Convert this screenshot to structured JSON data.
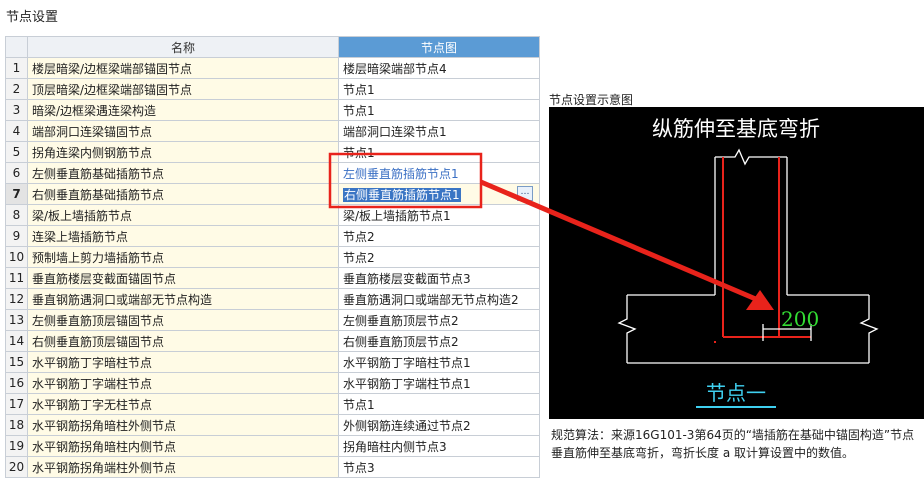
{
  "page_title": "节点设置",
  "table": {
    "col_name": "名称",
    "col_value": "节点图",
    "rows": [
      {
        "num": "1",
        "name": "楼层暗梁/边框梁端部锚固节点",
        "value": "楼层暗梁端部节点4"
      },
      {
        "num": "2",
        "name": "顶层暗梁/边框梁端部锚固节点",
        "value": "节点1"
      },
      {
        "num": "3",
        "name": "暗梁/边框梁遇连梁构造",
        "value": "节点1"
      },
      {
        "num": "4",
        "name": "端部洞口连梁锚固节点",
        "value": "端部洞口连梁节点1"
      },
      {
        "num": "5",
        "name": "拐角连梁内侧钢筋节点",
        "value": "节点1"
      },
      {
        "num": "6",
        "name": "左侧垂直筋基础插筋节点",
        "value": "左侧垂直筋插筋节点1"
      },
      {
        "num": "7",
        "name": "右侧垂直筋基础插筋节点",
        "value": "右侧垂直筋插筋节点1"
      },
      {
        "num": "8",
        "name": "梁/板上墙插筋节点",
        "value": "梁/板上墙插筋节点1"
      },
      {
        "num": "9",
        "name": "连梁上墙插筋节点",
        "value": "节点2"
      },
      {
        "num": "10",
        "name": "预制墙上剪力墙插筋节点",
        "value": "节点2"
      },
      {
        "num": "11",
        "name": "垂直筋楼层变截面锚固节点",
        "value": "垂直筋楼层变截面节点3"
      },
      {
        "num": "12",
        "name": "垂直钢筋遇洞口或端部无节点构造",
        "value": "垂直筋遇洞口或端部无节点构造2"
      },
      {
        "num": "13",
        "name": "左侧垂直筋顶层锚固节点",
        "value": "左侧垂直筋顶层节点2"
      },
      {
        "num": "14",
        "name": "右侧垂直筋顶层锚固节点",
        "value": "右侧垂直筋顶层节点2"
      },
      {
        "num": "15",
        "name": "水平钢筋丁字暗柱节点",
        "value": "水平钢筋丁字暗柱节点1"
      },
      {
        "num": "16",
        "name": "水平钢筋丁字端柱节点",
        "value": "水平钢筋丁字端柱节点1"
      },
      {
        "num": "17",
        "name": "水平钢筋丁字无柱节点",
        "value": "节点1"
      },
      {
        "num": "18",
        "name": "水平钢筋拐角暗柱外侧节点",
        "value": "外侧钢筋连续通过节点2"
      },
      {
        "num": "19",
        "name": "水平钢筋拐角暗柱内侧节点",
        "value": "拐角暗柱内侧节点3"
      },
      {
        "num": "20",
        "name": "水平钢筋拐角端柱外侧节点",
        "value": "节点3"
      }
    ]
  },
  "preview": {
    "label": "节点设置示意图",
    "heading": "纵筋伸至基底弯折",
    "dimension": "200",
    "caption": "节点一"
  },
  "description": {
    "line1": "规范算法：来源16G101-3第64页的“墙插筋在基础中锚固构造”节点",
    "line2": "垂直筋伸至基底弯折，弯折长度 a 取计算设置中的数值。"
  },
  "colors": {
    "accent": "#5b9bd5",
    "annotation_red": "#e8231b",
    "drawing_green": "#33dd33",
    "caption_cyan": "#3fd0f0"
  }
}
